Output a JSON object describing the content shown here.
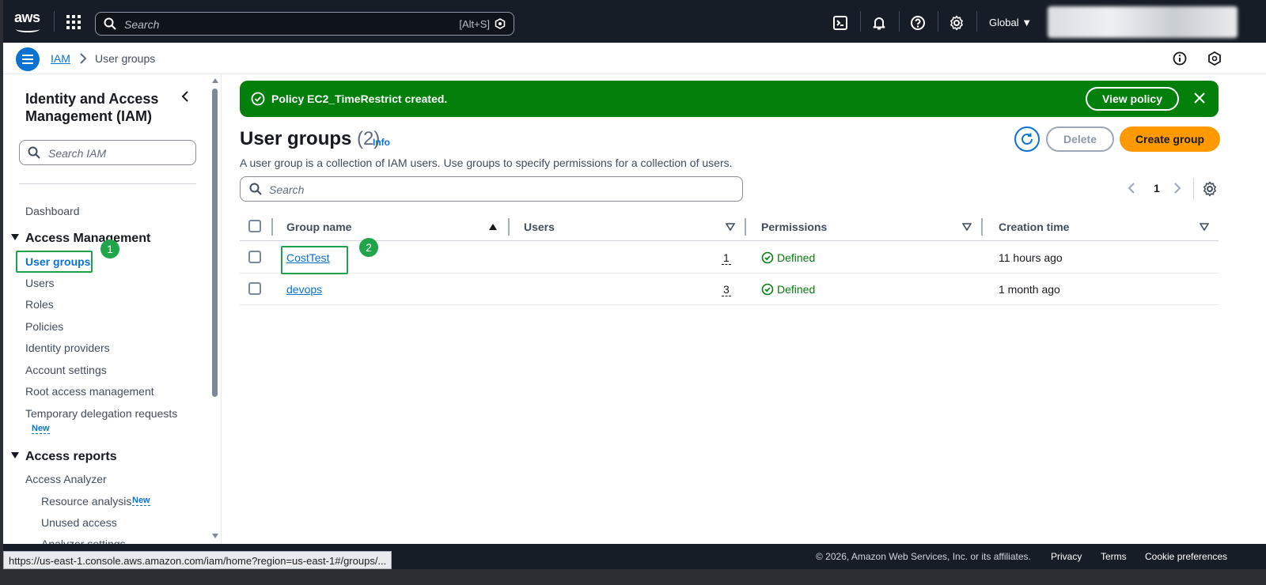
{
  "topnav": {
    "logo": "aws",
    "search_placeholder": "Search",
    "search_shortcut": "[Alt+S]",
    "region": "Global",
    "icons": [
      "apps-grid-icon",
      "cloudshell-icon",
      "bell-icon",
      "help-icon",
      "gear-icon"
    ]
  },
  "breadcrumb": {
    "root": "IAM",
    "current": "User groups"
  },
  "sidebar": {
    "title": "Identity and Access Management (IAM)",
    "search_placeholder": "Search IAM",
    "dashboard": "Dashboard",
    "access_management": {
      "label": "Access Management",
      "items": [
        "User groups",
        "Users",
        "Roles",
        "Policies",
        "Identity providers",
        "Account settings",
        "Root access management",
        "Temporary delegation requests"
      ],
      "new_tag": "New"
    },
    "access_reports": {
      "label": "Access reports",
      "analyzer": "Access Analyzer",
      "sub_items": [
        "Resource analysis",
        "Unused access",
        "Analyzer settings"
      ],
      "new_tag": "New"
    },
    "annotation_1": "1"
  },
  "flash": {
    "message": "Policy EC2_TimeRestrict created.",
    "action": "View policy",
    "color": "#037f0c"
  },
  "main": {
    "title": "User groups",
    "count": "(2)",
    "info": "Info",
    "description": "A user group is a collection of IAM users. Use groups to specify permissions for a collection of users.",
    "delete_label": "Delete",
    "create_label": "Create group",
    "search_placeholder": "Search",
    "page_number": "1",
    "annotation_2": "2"
  },
  "table": {
    "columns": [
      "Group name",
      "Users",
      "Permissions",
      "Creation time"
    ],
    "rows": [
      {
        "name": "CostTest",
        "users": "1",
        "permissions": "Defined",
        "created": "11 hours ago"
      },
      {
        "name": "devops",
        "users": "3",
        "permissions": "Defined",
        "created": "1 month ago"
      }
    ]
  },
  "footer": {
    "copyright": "© 2026, Amazon Web Services, Inc. or its affiliates.",
    "links": [
      "Privacy",
      "Terms",
      "Cookie preferences"
    ]
  },
  "status_url": "https://us-east-1.console.aws.amazon.com/iam/home?region=us-east-1#/groups/...",
  "colors": {
    "accent": "#0972d3",
    "nav_bg": "#161d26",
    "primary_button": "#ff9900",
    "annotation": "#21a54a"
  }
}
